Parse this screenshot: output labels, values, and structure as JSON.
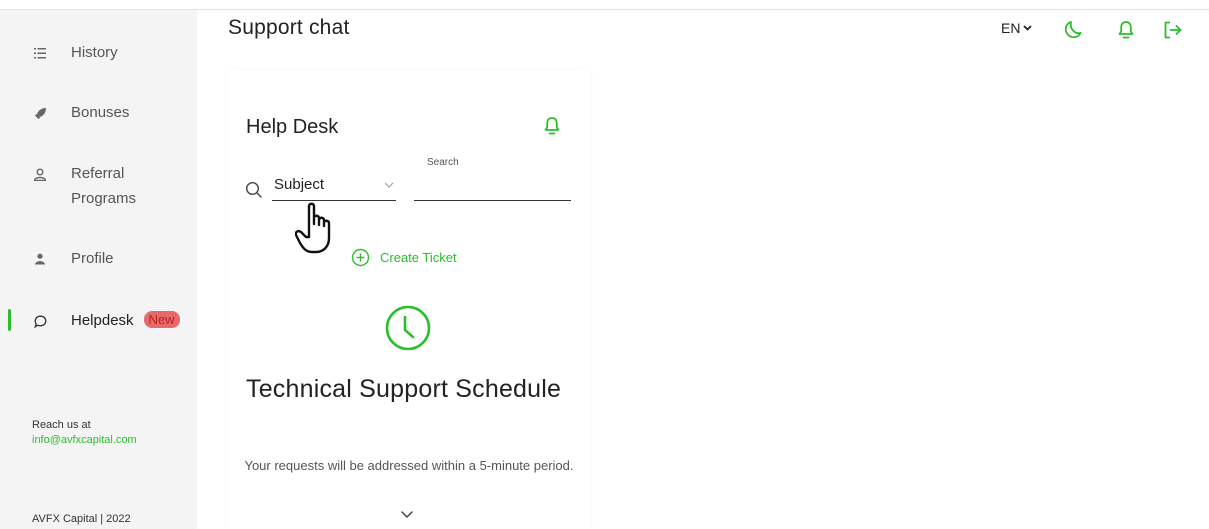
{
  "sidebar": {
    "items": [
      {
        "label": "History",
        "icon": "list-icon"
      },
      {
        "label": "Bonuses",
        "icon": "rocket-icon"
      },
      {
        "label": "Referral Programs",
        "icon": "users-icon"
      },
      {
        "label": "Profile",
        "icon": "person-icon"
      },
      {
        "label": "Helpdesk",
        "icon": "chat-icon",
        "badge": "New",
        "active": true
      }
    ],
    "reach_label": "Reach us at",
    "reach_email": "info@avfxcapital.com",
    "copyright": "AVFX Capital | 2022"
  },
  "header": {
    "title": "Support chat",
    "language": "EN",
    "icons": [
      "moon-icon",
      "bell-icon",
      "logout-icon"
    ]
  },
  "helpdesk": {
    "title": "Help Desk",
    "subject_value": "Subject",
    "search_label": "Search",
    "search_value": "",
    "create_ticket_label": "Create Ticket",
    "schedule_title": "Technical Support Schedule",
    "schedule_desc": "Your requests will be addressed within a 5-minute period."
  },
  "colors": {
    "accent": "#2dbd2d",
    "badge": "#e66a6a",
    "sidebar_bg": "#f4f4f4"
  }
}
